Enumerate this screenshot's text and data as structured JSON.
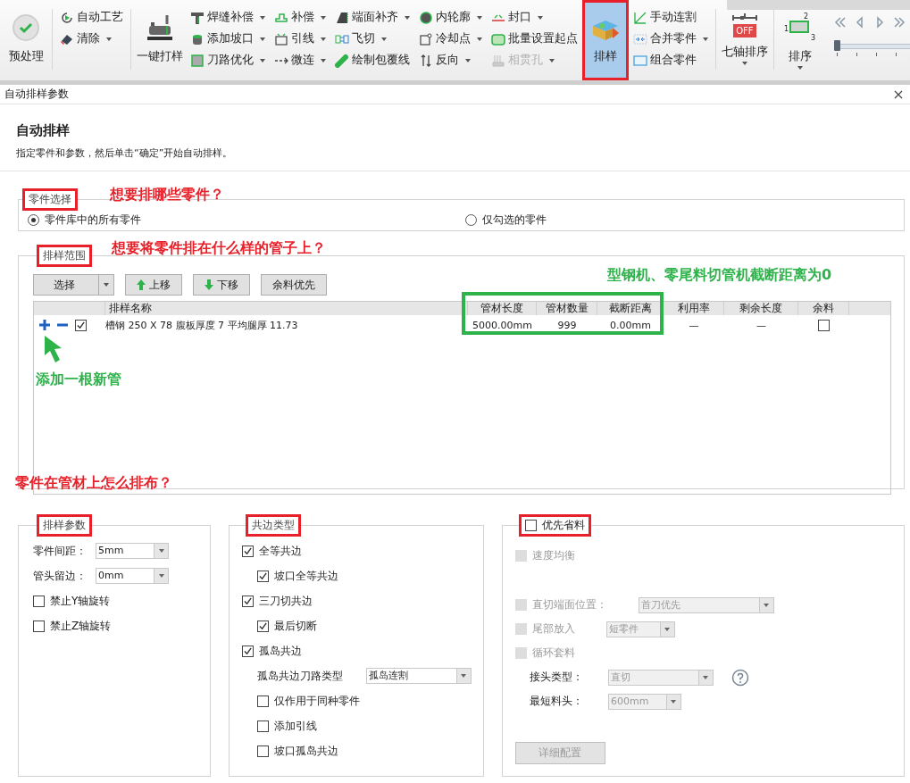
{
  "ribbon": {
    "columns": [
      {
        "kind": "large",
        "label": "预处理",
        "selected": false,
        "highlighted": false,
        "dropdown": false
      },
      {
        "kind": "separator"
      },
      {
        "kind": "stack",
        "items": [
          {
            "label": "自动工艺",
            "dropdown": false,
            "disabled": false
          },
          {
            "label": "清除",
            "dropdown": true,
            "disabled": false
          }
        ]
      },
      {
        "kind": "separator"
      },
      {
        "kind": "large",
        "label": "一键打样",
        "selected": false,
        "highlighted": false,
        "dropdown": false
      },
      {
        "kind": "stack",
        "items": [
          {
            "label": "焊缝补偿",
            "dropdown": true,
            "disabled": false
          },
          {
            "label": "添加坡口",
            "dropdown": true,
            "disabled": false
          },
          {
            "label": "刀路优化",
            "dropdown": true,
            "disabled": false
          }
        ]
      },
      {
        "kind": "stack",
        "items": [
          {
            "label": "补偿",
            "dropdown": true,
            "disabled": false
          },
          {
            "label": "引线",
            "dropdown": true,
            "disabled": false
          },
          {
            "label": "微连",
            "dropdown": true,
            "disabled": false
          }
        ]
      },
      {
        "kind": "stack",
        "items": [
          {
            "label": "端面补齐",
            "dropdown": true,
            "disabled": false
          },
          {
            "label": "飞切",
            "dropdown": true,
            "disabled": false
          },
          {
            "label": "绘制包覆线",
            "dropdown": false,
            "disabled": false
          }
        ]
      },
      {
        "kind": "stack",
        "items": [
          {
            "label": "内轮廓",
            "dropdown": true,
            "disabled": false
          },
          {
            "label": "冷却点",
            "dropdown": true,
            "disabled": false
          },
          {
            "label": "反向",
            "dropdown": true,
            "disabled": false
          }
        ]
      },
      {
        "kind": "stack",
        "items": [
          {
            "label": "封口",
            "dropdown": true,
            "disabled": false
          },
          {
            "label": "批量设置起点",
            "dropdown": false,
            "disabled": false
          },
          {
            "label": "相贯孔",
            "dropdown": true,
            "disabled": true
          }
        ]
      },
      {
        "kind": "large",
        "label": "排样",
        "selected": true,
        "highlighted": true,
        "dropdown": false
      },
      {
        "kind": "stack",
        "items": [
          {
            "label": "手动连割",
            "dropdown": false,
            "disabled": false
          },
          {
            "label": "合并零件",
            "dropdown": true,
            "disabled": false
          },
          {
            "label": "组合零件",
            "dropdown": false,
            "disabled": false
          }
        ]
      },
      {
        "kind": "separator"
      },
      {
        "kind": "large",
        "label": "七轴排序",
        "selected": false,
        "highlighted": false,
        "dropdown": true,
        "badge": "OFF"
      },
      {
        "kind": "separator"
      },
      {
        "kind": "large",
        "label": "排序",
        "selected": false,
        "highlighted": false,
        "dropdown": true,
        "icon_labels": [
          "2",
          "1",
          "3"
        ]
      },
      {
        "kind": "slider",
        "level": 0
      }
    ]
  },
  "dialog": {
    "title": "自动排样参数",
    "heading": "自动排样",
    "description": "指定零件和参数，然后单击“确定”开始自动排样。"
  },
  "parts_selection": {
    "title": "零件选择",
    "highlighted": true,
    "options": [
      {
        "label": "零件库中的所有零件",
        "selected": true
      },
      {
        "label": "仅勾选的零件",
        "selected": false
      }
    ]
  },
  "nesting_range": {
    "title": "排样范围",
    "highlighted": true,
    "buttons": [
      {
        "label": "选择",
        "kind": "split"
      },
      {
        "label": "上移",
        "kind": "up"
      },
      {
        "label": "下移",
        "kind": "down"
      },
      {
        "label": "余料优先",
        "kind": "plain"
      }
    ],
    "table": {
      "columns": [
        "排样名称",
        "管材长度",
        "管材数量",
        "截断距离",
        "利用率",
        "剩余长度",
        "余料"
      ],
      "highlight_frame": {
        "color": "#2eb34b"
      },
      "rows": [
        {
          "checked": true,
          "name": "槽钢 250 X 78 腹板厚度 7 平均腿厚 11.73",
          "length": "5000.00mm",
          "count": "999",
          "cut_distance": "0.00mm",
          "utilization": "—",
          "remaining": "—",
          "remnant": false
        }
      ]
    }
  },
  "nesting_params": {
    "title": "排样参数",
    "highlighted": true,
    "fields": [
      {
        "label": "零件间距：",
        "value": "5mm"
      },
      {
        "label": "管头留边：",
        "value": "0mm"
      }
    ],
    "checkboxes": [
      {
        "label": "禁止Y轴旋转",
        "checked": false
      },
      {
        "label": "禁止Z轴旋转",
        "checked": false
      }
    ]
  },
  "common_edge": {
    "title": "共边类型",
    "highlighted": true,
    "items": [
      {
        "kind": "check",
        "label": "全等共边",
        "checked": true,
        "children": [
          {
            "kind": "check",
            "label": "坡口全等共边",
            "checked": true
          }
        ]
      },
      {
        "kind": "check",
        "label": "三刀切共边",
        "checked": true,
        "children": [
          {
            "kind": "check",
            "label": "最后切断",
            "checked": true
          }
        ]
      },
      {
        "kind": "check",
        "label": "孤岛共边",
        "checked": true,
        "children": [
          {
            "kind": "select",
            "label": "孤岛共边刀路类型",
            "value": "孤岛连割"
          },
          {
            "kind": "check",
            "label": "仅作用于同种零件",
            "checked": false
          },
          {
            "kind": "check",
            "label": "添加引线",
            "checked": false
          },
          {
            "kind": "check",
            "label": "坡口孤岛共边",
            "checked": false
          }
        ]
      }
    ]
  },
  "material_saving": {
    "title": "优先省料",
    "checked": false,
    "highlighted": true,
    "disabled": true,
    "items": [
      {
        "kind": "check",
        "label": "速度均衡",
        "checked": false
      },
      {
        "kind": "check_select",
        "label": "直切端面位置：",
        "checked": false,
        "value": "首刀优先"
      },
      {
        "kind": "check_select",
        "label": "尾部放入",
        "checked": false,
        "value": "短零件"
      },
      {
        "kind": "check",
        "label": "循环套料",
        "checked": false
      },
      {
        "kind": "field",
        "label": "接头类型：",
        "value": "直切",
        "help": true
      },
      {
        "kind": "field",
        "label": "最短料头：",
        "value": "600mm",
        "help": false
      }
    ],
    "button": "详细配置"
  },
  "annotations": [
    {
      "kind": "note",
      "text": "想要排哪些零件？",
      "color": "#e8202a"
    },
    {
      "kind": "note",
      "text": "想要将零件排在什么样的管子上？",
      "color": "#e8202a"
    },
    {
      "kind": "note",
      "text": "型钢机、零尾料切管机截断距离为0",
      "color": "#2eb34b"
    },
    {
      "kind": "arrow",
      "color": "#2eb34b"
    },
    {
      "kind": "note",
      "text": "添加一根新管",
      "color": "#2eb34b"
    },
    {
      "kind": "note",
      "text": "零件在管材上怎么排布？",
      "color": "#e8202a"
    }
  ]
}
